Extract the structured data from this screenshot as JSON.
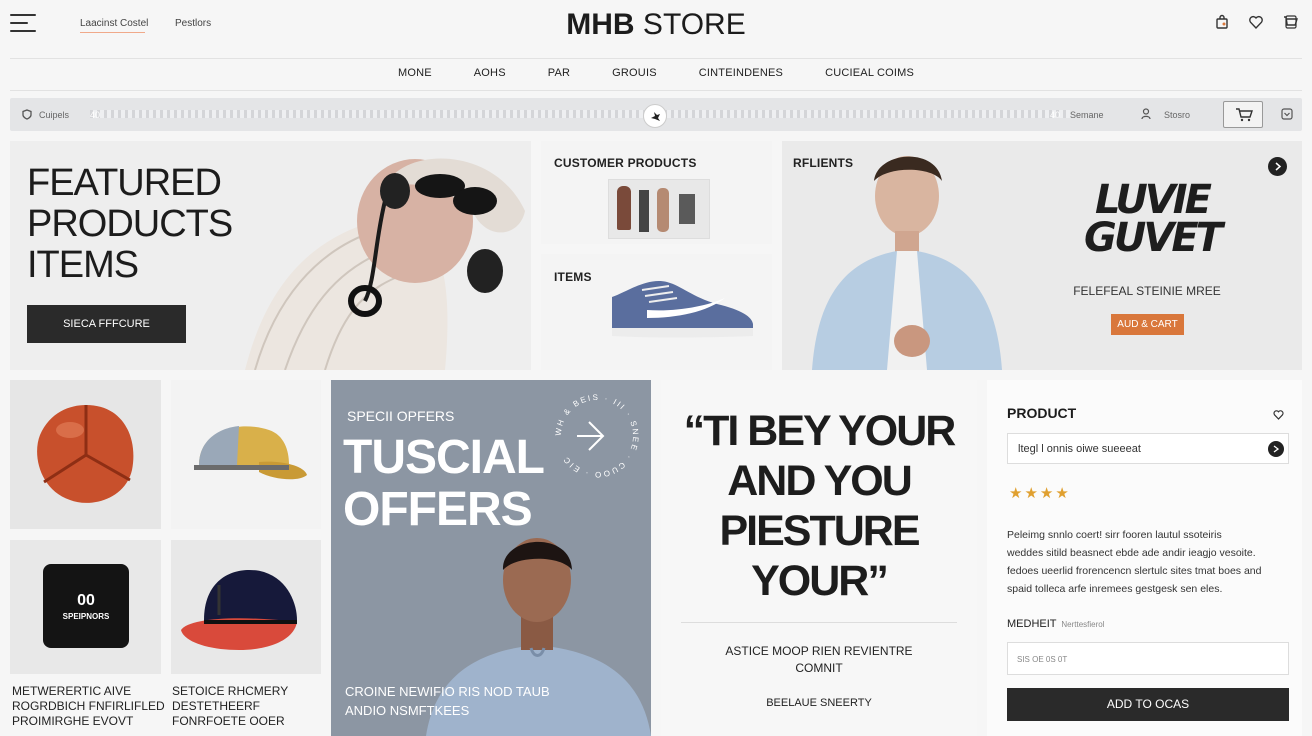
{
  "header": {
    "links": [
      "Laacinst Costel",
      "Pestlors"
    ],
    "brand_bold": "MHB",
    "brand_light": " STORE",
    "icons": [
      "bag-icon",
      "heart-icon",
      "cart-icon"
    ]
  },
  "nav": {
    "items": [
      "MONE",
      "AOHS",
      "PAR",
      "GROUIS",
      "CINTEINDENES",
      "CUCIEAL COIMS"
    ]
  },
  "utility_bar": {
    "left_label": "Cuipels",
    "left_mark": "40",
    "right_mark": "40",
    "label_a": "Semane",
    "label_b": "Stosro"
  },
  "hero": {
    "title_lines": [
      "FEATURED",
      "PRODUCTS",
      "ITEMS"
    ],
    "cta": "SIECA FFFCURE"
  },
  "customer_card": {
    "title": "CUSTOMER PRODUCTS"
  },
  "items_card": {
    "title": "ITEMS"
  },
  "featured_card": {
    "title": "RFLIENTS",
    "graphic_text": "LUVIE\nGUVET",
    "subtitle": "FELEFEAL STEINIE MREE",
    "cta": "AUD & CART"
  },
  "products_grid": {
    "captions": [
      [
        "METWERERTIC AIVE",
        "ROGRDBICH FNFIRLIFLED",
        "PROIMIRGHE EVOVT"
      ],
      [
        "SETOICE RHCMERY",
        "DESTETHEERF",
        "FONRFOETE OOER"
      ]
    ],
    "puck_number": "00",
    "puck_text": "SPEIPNORS"
  },
  "offers": {
    "eyebrow": "SPECII OPFERS",
    "title_lines": [
      "TUSCIAL",
      "OFFERS"
    ],
    "badge_text": "WH & BEIS · III · SNEE · CUOO · EIC",
    "footer_lines": [
      "CROINE NEWIFIO RIS NOD TAUB",
      "ANDIO NSMFTKEES"
    ]
  },
  "quote": {
    "lines": [
      "“TI BEY YOUR",
      "AND YOU",
      "PIESTURE",
      "YOUR”"
    ],
    "caption_lines": [
      "ASTICE MOOP RIEN REVIENTRE",
      "COMNIT"
    ],
    "sign": "BEELAUE SNEERTY"
  },
  "product_panel": {
    "title": "PRODUCT",
    "search_value": "ltegl l onnis oiwe sueeeat",
    "rating": 4,
    "description": [
      "Peleimg snnlo coert! sirr fooren lautul ssoteiris",
      "weddes sitild beasnect ebde ade andir ieagjo vesoite.",
      "fedoes ueerlid frorencencn slertulc sites tmat boes and",
      "spaid tolleca arfe inremees gestgesk sen eles."
    ],
    "field_label": "MEDHEIT",
    "field_hint": "Nerttesfierol",
    "field_placeholder": "SIS OE 0S 0T",
    "add_button": "ADD TO OCAS"
  },
  "colors": {
    "accent": "#d9773b",
    "dark": "#2a2a2a",
    "offers_bg": "#8c96a3"
  }
}
